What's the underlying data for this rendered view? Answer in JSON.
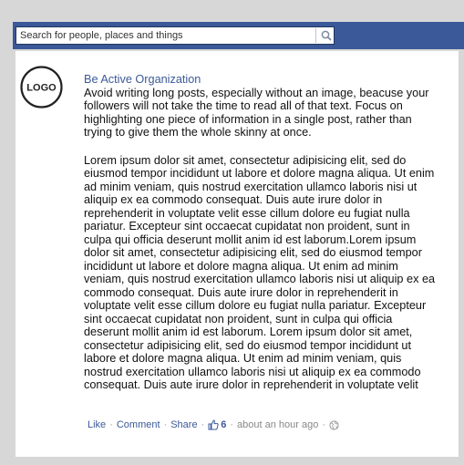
{
  "search": {
    "placeholder": "Search for people, places and things"
  },
  "post": {
    "logo_text": "LOGO",
    "author": "Be Active Organization",
    "intro": "Avoid writing long posts, especially without an image, beacuse your followers will not take the time to read all of that text. Focus on highlighting one piece of information in a single post, rather than trying to give them the whole skinny at once.",
    "body": "Lorem ipsum dolor sit amet, consectetur adipisicing elit, sed do eiusmod tempor incididunt ut labore et dolore magna aliqua. Ut enim ad minim veniam, quis nostrud exercitation ullamco laboris nisi ut aliquip ex ea commodo consequat. Duis aute irure dolor in reprehenderit in voluptate velit esse cillum dolore eu fugiat nulla pariatur. Excepteur sint occaecat cupidatat non proident, sunt in culpa qui officia deserunt mollit anim id est laborum.Lorem ipsum dolor sit amet, consectetur adipisicing elit, sed do eiusmod tempor incididunt ut labore et dolore magna aliqua. Ut enim ad minim veniam, quis nostrud exercitation ullamco laboris nisi ut aliquip ex ea commodo consequat. Duis aute irure dolor in reprehenderit in voluptate velit esse cillum dolore eu fugiat nulla pariatur. Excepteur sint occaecat cupidatat non proident, sunt in culpa qui officia deserunt mollit anim id est laborum. Lorem ipsum dolor sit amet, consectetur adipisicing elit, sed do eiusmod tempor incididunt ut labore et dolore magna aliqua. Ut enim ad minim veniam, quis nostrud exercitation ullamco laboris nisi ut aliquip ex ea commodo consequat. Duis aute irure dolor in reprehenderit in voluptate velit"
  },
  "actions": {
    "like": "Like",
    "comment": "Comment",
    "share": "Share",
    "like_count": "6",
    "timestamp": "about an hour ago",
    "sep": "·"
  },
  "colors": {
    "header_bg": "#3b5998",
    "link": "#3b5998",
    "page_bg": "#d7d7d7"
  },
  "icons": [
    "search-icon",
    "thumbs-up-icon",
    "globe-icon"
  ]
}
